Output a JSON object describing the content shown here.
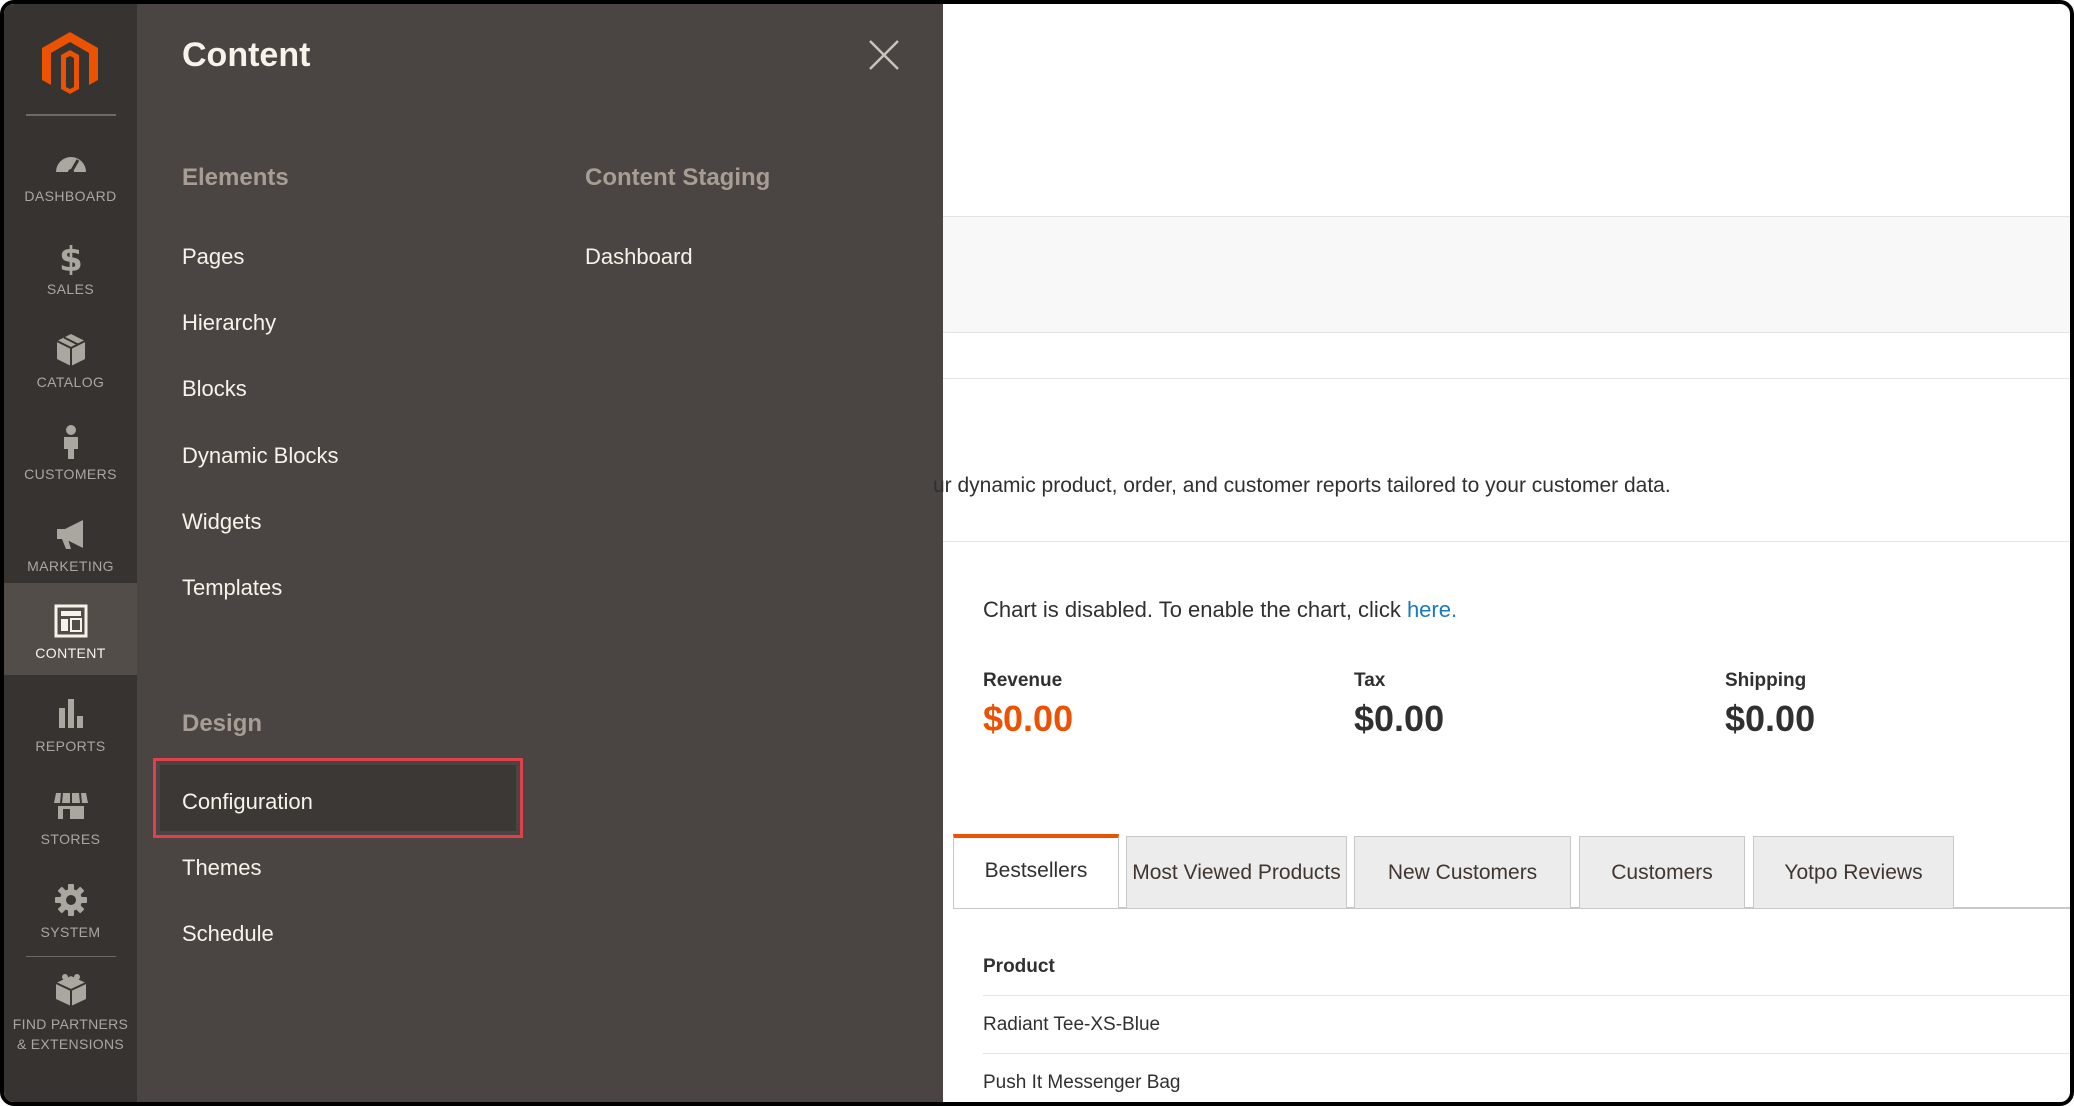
{
  "nav": {
    "items": [
      {
        "label": "DASHBOARD",
        "icon": "speedometer-icon"
      },
      {
        "label": "SALES",
        "icon": "dollar-icon"
      },
      {
        "label": "CATALOG",
        "icon": "box-icon"
      },
      {
        "label": "CUSTOMERS",
        "icon": "person-icon"
      },
      {
        "label": "MARKETING",
        "icon": "megaphone-icon"
      },
      {
        "label": "CONTENT",
        "icon": "layout-icon"
      },
      {
        "label": "REPORTS",
        "icon": "bar-chart-icon"
      },
      {
        "label": "STORES",
        "icon": "storefront-icon"
      },
      {
        "label": "SYSTEM",
        "icon": "gear-icon"
      }
    ],
    "partners_line1": "FIND PARTNERS",
    "partners_line2": "& EXTENSIONS",
    "active": "CONTENT",
    "colors": {
      "rail": "#373330",
      "active": "#524d49",
      "logo": "#eb5202"
    }
  },
  "menu": {
    "title": "Content",
    "elements": {
      "title": "Elements",
      "links": [
        "Pages",
        "Hierarchy",
        "Blocks",
        "Dynamic Blocks",
        "Widgets",
        "Templates"
      ]
    },
    "staging": {
      "title": "Content Staging",
      "links": [
        "Dashboard"
      ]
    },
    "design": {
      "title": "Design",
      "links": [
        "Configuration",
        "Themes",
        "Schedule"
      ],
      "highlighted": "Configuration"
    },
    "highlight_color": "#e0404a"
  },
  "dashboard": {
    "info_text": "ur dynamic product, order, and customer reports tailored to your customer data.",
    "chart_msg": "Chart is disabled. To enable the chart, click ",
    "chart_link": "here.",
    "stats": [
      {
        "label": "Revenue",
        "value": "$0.00"
      },
      {
        "label": "Tax",
        "value": "$0.00"
      },
      {
        "label": "Shipping",
        "value": "$0.00"
      }
    ],
    "tabs": [
      "Bestsellers",
      "Most Viewed Products",
      "New Customers",
      "Customers",
      "Yotpo Reviews"
    ],
    "active_tab": "Bestsellers",
    "table": {
      "header": "Product",
      "rows": [
        "Radiant Tee-XS-Blue",
        "Push It Messenger Bag"
      ]
    },
    "accent_color": "#eb5202",
    "link_color": "#1979c3"
  }
}
